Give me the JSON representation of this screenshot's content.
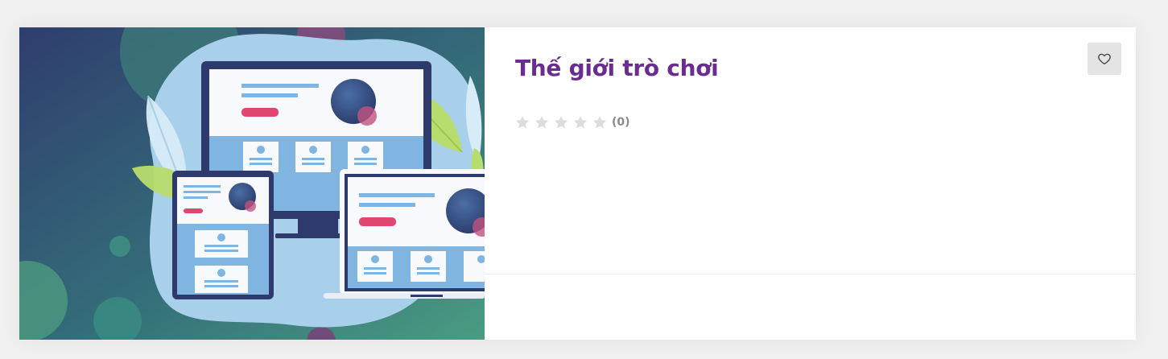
{
  "course": {
    "title": "Thế giới trò chơi",
    "rating": 0,
    "rating_count": "(0)",
    "star_icons": [
      "star-icon",
      "star-icon",
      "star-icon",
      "star-icon",
      "star-icon"
    ],
    "wishlist_icon": "heart-icon"
  },
  "colors": {
    "title": "#6a2c91",
    "star_empty": "#dcdcdc",
    "wishlist_bg": "#e4e4e4"
  }
}
